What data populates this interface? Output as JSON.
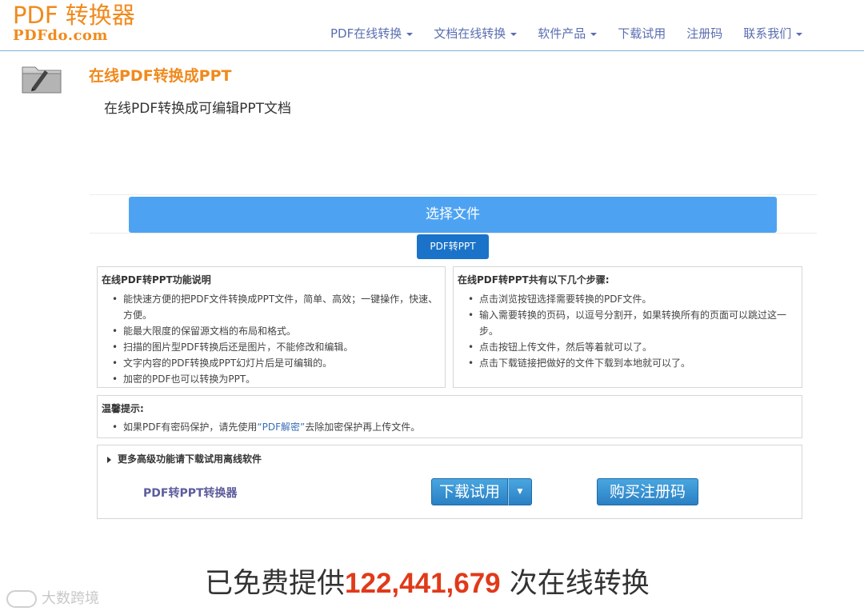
{
  "header": {
    "logo_top": "PDF 转换器",
    "logo_bottom": "PDFdo.com",
    "nav": [
      {
        "label": "PDF在线转换",
        "dropdown": true
      },
      {
        "label": "文档在线转换",
        "dropdown": true
      },
      {
        "label": "软件产品",
        "dropdown": true
      },
      {
        "label": "下载试用",
        "dropdown": false
      },
      {
        "label": "注册码",
        "dropdown": false
      },
      {
        "label": "联系我们",
        "dropdown": true
      }
    ]
  },
  "page": {
    "title": "在线PDF转换成PPT",
    "subtitle": "在线PDF转换成可编辑PPT文档",
    "select_button": "选择文件",
    "convert_button": "PDF转PPT"
  },
  "features": {
    "title": "在线PDF转PPT功能说明",
    "items": [
      "能快速方便的把PDF文件转换成PPT文件，简单、高效；一键操作，快速、方便。",
      "能最大限度的保留源文档的布局和格式。",
      "扫描的图片型PDF转换后还是图片，不能修改和编辑。",
      "文字内容的PDF转换成PPT幻灯片后是可编辑的。",
      "加密的PDF也可以转换为PPT。"
    ]
  },
  "steps": {
    "title": "在线PDF转PPT共有以下几个步骤:",
    "items": [
      "点击浏览按钮选择需要转换的PDF文件。",
      "输入需要转换的页码，以逗号分割开，如果转换所有的页面可以跳过这一步。",
      "点击按钮上传文件，然后等着就可以了。",
      "点击下载链接把做好的文件下载到本地就可以了。"
    ]
  },
  "tips": {
    "title": "温馨提示:",
    "before": "如果PDF有密码保护，请先使用",
    "link": "“PDF解密”",
    "after": "去除加密保护再上传文件。"
  },
  "more": {
    "title": "更多高级功能请下载试用离线软件",
    "product": "PDF转PPT转换器",
    "download_button": "下载试用",
    "buy_button": "购买注册码"
  },
  "counter": {
    "prefix": "已免费提供",
    "number": "122,441,679",
    "suffix": " 次在线转换"
  },
  "watermark": "大数跨境",
  "colors": {
    "brand_orange": "#f08a1c",
    "nav_text": "#5a6eb0",
    "primary_blue": "#4da3f2",
    "dark_blue": "#1a73c9",
    "counter_red": "#e03a1a"
  }
}
